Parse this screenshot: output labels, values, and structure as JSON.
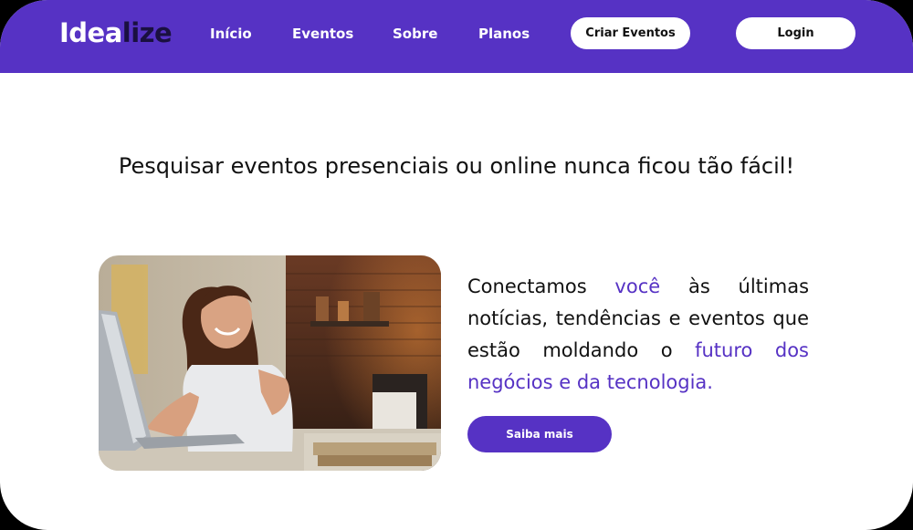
{
  "header": {
    "logo_part1": "Idea",
    "logo_part2": "lize",
    "nav": [
      "Início",
      "Eventos",
      "Sobre",
      "Planos"
    ],
    "create_events_label": "Criar Eventos",
    "login_label": "Login"
  },
  "main": {
    "headline": "Pesquisar eventos presenciais ou online nunca ficou tão fácil!",
    "desc": {
      "p1": "Conectamos ",
      "hl1": "você",
      "p2": " às últimas notícias, tendências e eventos que estão moldando o ",
      "hl2": "futuro dos negócios e da tecnologia."
    },
    "cta_label": "Saiba mais"
  },
  "colors": {
    "brand": "#5632c4",
    "logo_dark": "#1a1040",
    "background": "#ffffff"
  }
}
